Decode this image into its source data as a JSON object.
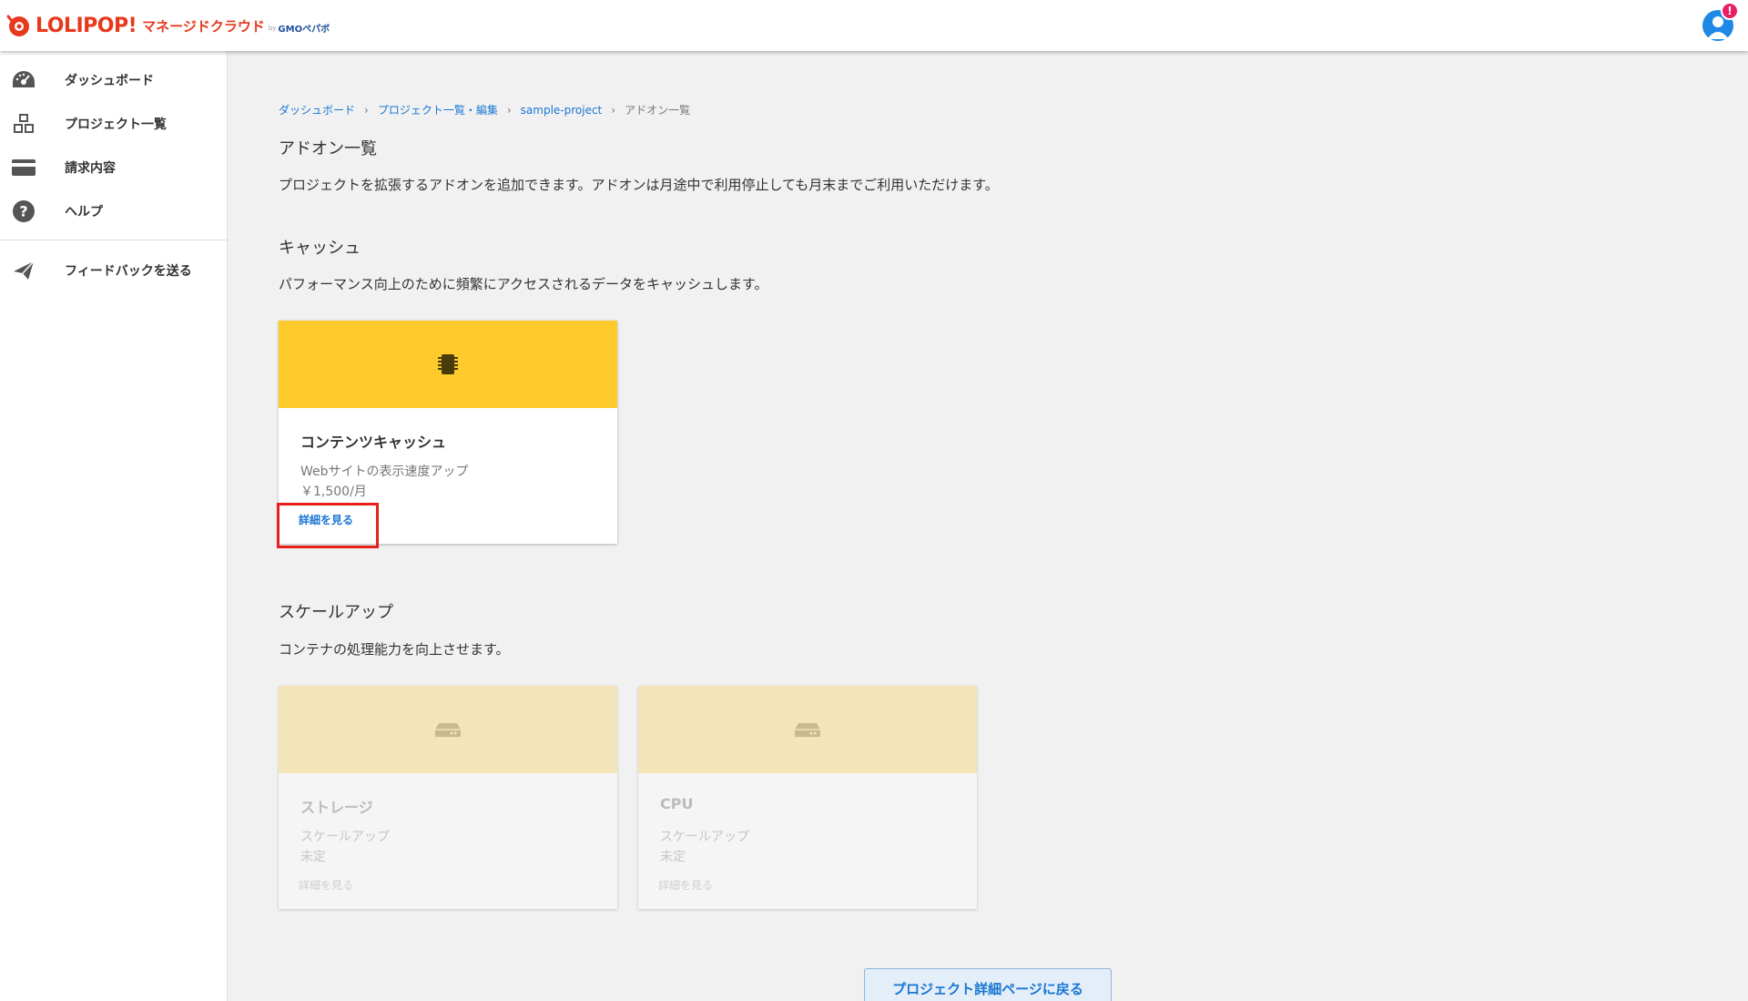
{
  "header": {
    "logo_main": "LOLIPOP!",
    "logo_sub": "マネージドクラウド",
    "logo_by": "by",
    "logo_gmo": "GMOペパボ",
    "notification_count": "!"
  },
  "sidebar": {
    "items": [
      {
        "label": "ダッシュボード",
        "icon": "speedometer-icon"
      },
      {
        "label": "プロジェクト一覧",
        "icon": "cubes-icon"
      },
      {
        "label": "請求内容",
        "icon": "credit-card-icon"
      },
      {
        "label": "ヘルプ",
        "icon": "help-circle-icon"
      }
    ],
    "feedback": {
      "label": "フィードバックを送る",
      "icon": "send-icon"
    }
  },
  "breadcrumb": {
    "items": [
      "ダッシュボード",
      "プロジェクト一覧・編集",
      "sample-project"
    ],
    "current": "アドオン一覧"
  },
  "page": {
    "title": "アドオン一覧",
    "description": "プロジェクトを拡張するアドオンを追加できます。アドオンは月途中で利用停止しても月末までご利用いただけます。"
  },
  "sections": [
    {
      "title": "キャッシュ",
      "description": "パフォーマンス向上のために頻繁にアクセスされるデータをキャッシュします。",
      "cards": [
        {
          "name": "コンテンツキャッシュ",
          "subtitle": "Webサイトの表示速度アップ",
          "price": "￥1,500/月",
          "link": "詳細を見る",
          "icon": "chip-icon",
          "enabled": true
        }
      ]
    },
    {
      "title": "スケールアップ",
      "description": "コンテナの処理能力を向上させます。",
      "cards": [
        {
          "name": "ストレージ",
          "subtitle": "スケールアップ",
          "price": "未定",
          "link": "詳細を見る",
          "icon": "storage-drive-icon",
          "enabled": false
        },
        {
          "name": "CPU",
          "subtitle": "スケールアップ",
          "price": "未定",
          "link": "詳細を見る",
          "icon": "storage-drive-icon",
          "enabled": false
        }
      ]
    }
  ],
  "back_button": "プロジェクト詳細ページに戻る",
  "colors": {
    "brand": "#e8391d",
    "link": "#1976d2",
    "card_header": "#ffca2c",
    "card_header_disabled": "#f4e4b9",
    "highlight": "#e8201b"
  }
}
